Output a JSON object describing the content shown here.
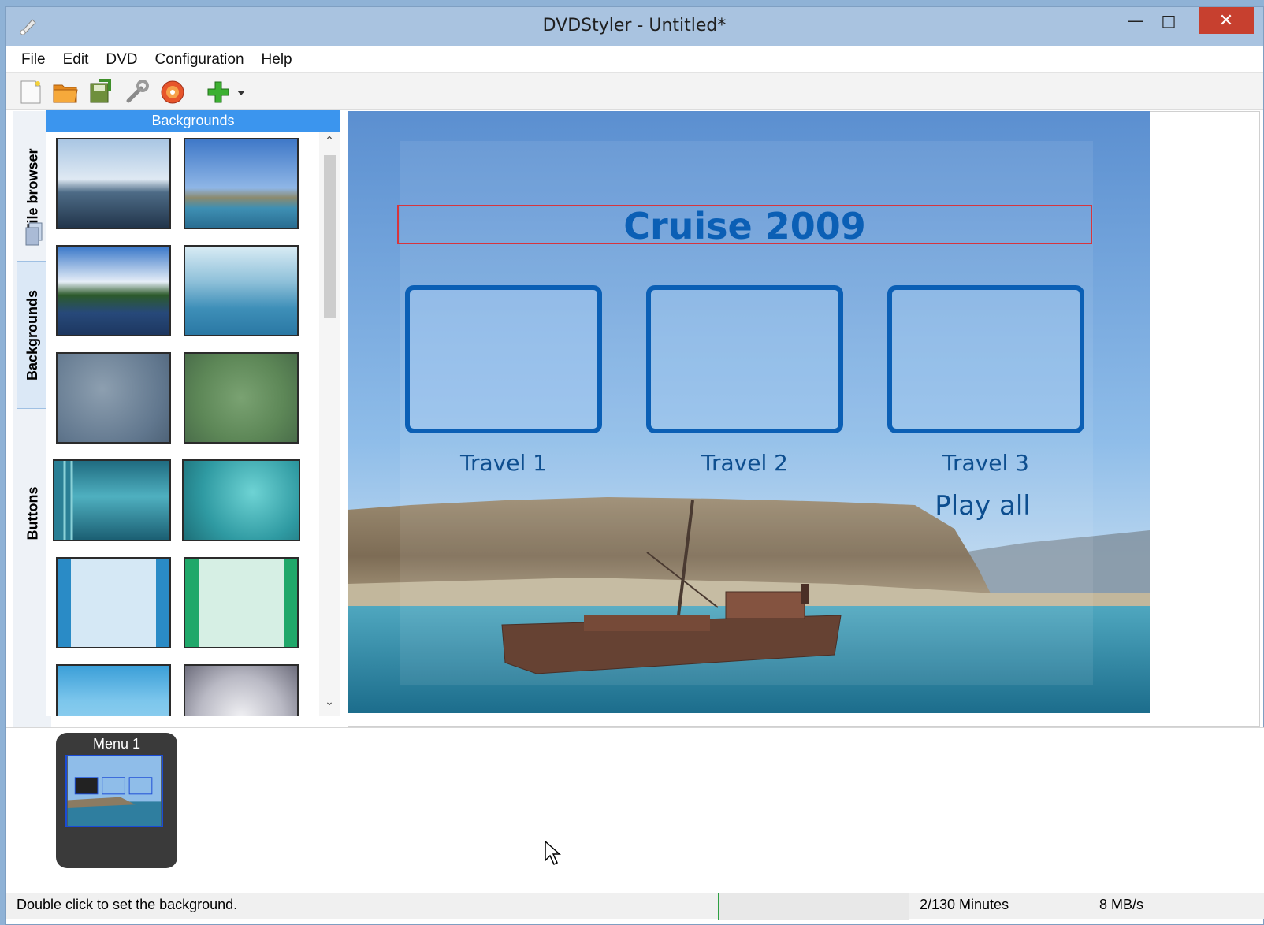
{
  "window": {
    "title": "DVDStyler - Untitled*"
  },
  "menubar": {
    "items": [
      "File",
      "Edit",
      "DVD",
      "Configuration",
      "Help"
    ]
  },
  "side_tabs": {
    "file_browser": "File browser",
    "backgrounds": "Backgrounds",
    "buttons": "Buttons"
  },
  "panel": {
    "title": "Backgrounds"
  },
  "menu_canvas": {
    "title": "Cruise 2009",
    "buttons": [
      "Travel 1",
      "Travel 2",
      "Travel 3"
    ],
    "play_all": "Play all"
  },
  "titles": {
    "menu_label": "Menu 1"
  },
  "status": {
    "message": "Double click to set the background.",
    "duration": "2/130 Minutes",
    "speed": "8 MB/s"
  },
  "colors": {
    "accent": "#3b95ee",
    "title_blue": "#0b5fb5",
    "close_red": "#c7402f"
  }
}
